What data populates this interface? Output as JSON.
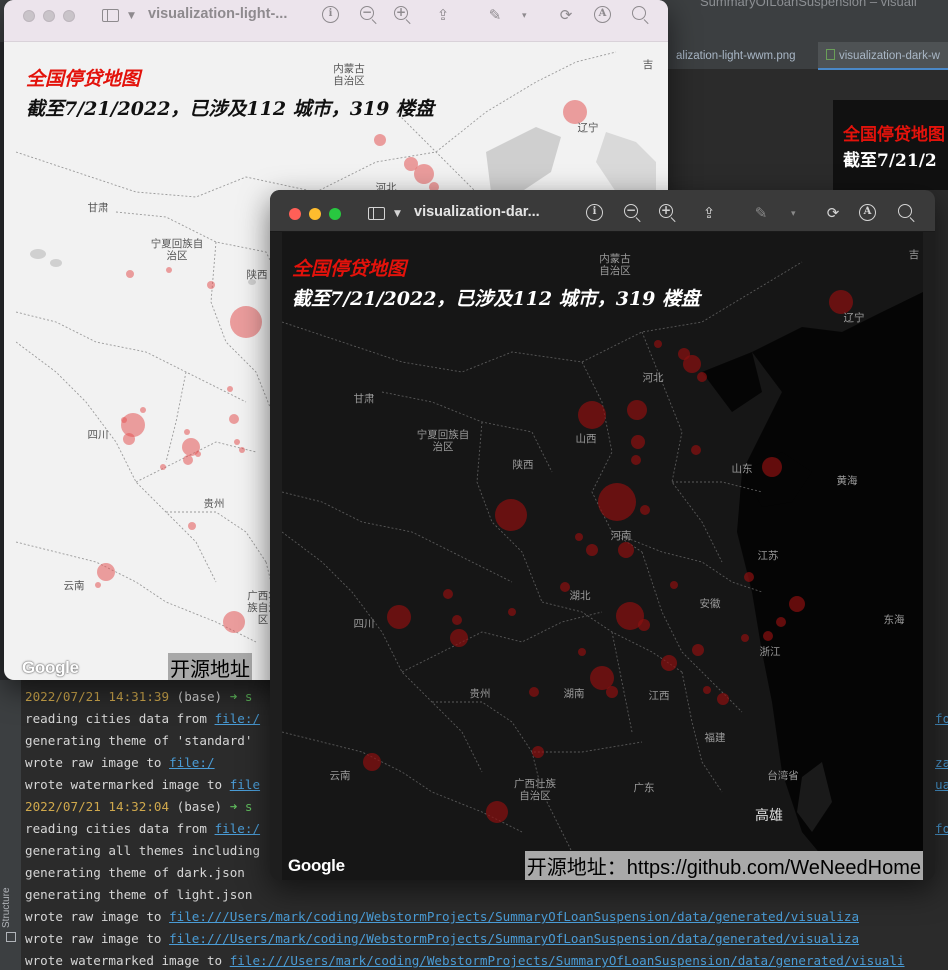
{
  "ide": {
    "window_title": "SummaryOfLoanSuspension – visuali",
    "tabs": [
      {
        "label": "alization-light-wwm.png",
        "active": false
      },
      {
        "label": "visualization-dark-w",
        "active": true
      }
    ],
    "editor_preview": {
      "title": "全国停贷地图",
      "subtitle": "截至7/21/2"
    },
    "structure_label": "Structure"
  },
  "terminal": {
    "lines": [
      {
        "ts": "2022/07/21 14:31:39",
        "rest": " (base) ",
        "arrow": "➜",
        "tail": "  s"
      },
      {
        "text": "reading cities data from ",
        "link": "file:/",
        "tail": "",
        "link2": "fo"
      },
      {
        "text": "generating theme of 'standard'",
        "link": "",
        "tail": ""
      },
      {
        "text": "wrote raw       image to ",
        "link": "file:/",
        "tail": "",
        "link2": "za"
      },
      {
        "text": "wrote watermarked image to ",
        "link": "file",
        "tail": "",
        "link2": "ua"
      },
      {
        "ts": "2022/07/21 14:32:04",
        "rest": " (base) ",
        "arrow": "➜",
        "tail": "  s"
      },
      {
        "text": "reading cities data from ",
        "link": "file:/",
        "tail": "",
        "link2": "fo"
      },
      {
        "text": "generating all themes including",
        "link": "",
        "tail": ""
      },
      {
        "text": "generating theme of dark.json",
        "link": "",
        "tail": ""
      },
      {
        "text": "generating theme of light.json",
        "link": "",
        "tail": ""
      },
      {
        "text": "wrote raw       image to ",
        "link": "file:///Users/mark/coding/WebstormProjects/SummaryOfLoanSuspension/data/generated/visualiza",
        "tail": ""
      },
      {
        "text": "wrote raw       image to ",
        "link": "file:///Users/mark/coding/WebstormProjects/SummaryOfLoanSuspension/data/generated/visualiza",
        "tail": ""
      },
      {
        "text": "wrote watermarked image to ",
        "link": "file:///Users/mark/coding/WebstormProjects/SummaryOfLoanSuspension/data/generated/visuali",
        "tail": ""
      }
    ]
  },
  "light_window": {
    "title": "visualization-light-...",
    "map_title": "全国停贷地图",
    "map_subtitle": "截至7/21/2022，已涉及112 城市，319 楼盘",
    "google": "Google",
    "watermark": "开源地址",
    "labels": [
      "内蒙古自治区",
      "辽宁",
      "甘肃",
      "宁夏回族自治区",
      "陕西",
      "四川",
      "贵州",
      "云南",
      "广西壮族自治区",
      "河北",
      "吉"
    ]
  },
  "dark_window": {
    "title": "visualization-dar...",
    "map_title": "全国停贷地图",
    "map_subtitle": "截至7/21/2022，已涉及112 城市，319 楼盘",
    "google": "Google",
    "watermark": "开源地址：https://github.com/WeNeedHome",
    "labels": [
      "内蒙古自治区",
      "吉",
      "辽宁",
      "河北",
      "山西",
      "甘肃",
      "宁夏回族自治区",
      "陕西",
      "山东",
      "黄海",
      "河南",
      "江苏",
      "安徽",
      "湖北",
      "四川",
      "东海",
      "浙江",
      "湖南",
      "江西",
      "贵州",
      "福建",
      "云南",
      "台湾省",
      "广西壮族自治区",
      "广东",
      "高雄"
    ]
  },
  "colors": {
    "accent_red": "#e3120b",
    "dot_red": "#c62828",
    "link_blue": "#4a9cd6"
  },
  "icons": [
    "sidebar-icon",
    "chevron-down-icon",
    "info-icon",
    "zoom-out-icon",
    "zoom-in-icon",
    "share-icon",
    "markup-pen-icon",
    "rotate-icon",
    "annotate-icon",
    "search-icon",
    "close-dot-icon",
    "minimize-dot-icon",
    "zoom-dot-icon"
  ]
}
